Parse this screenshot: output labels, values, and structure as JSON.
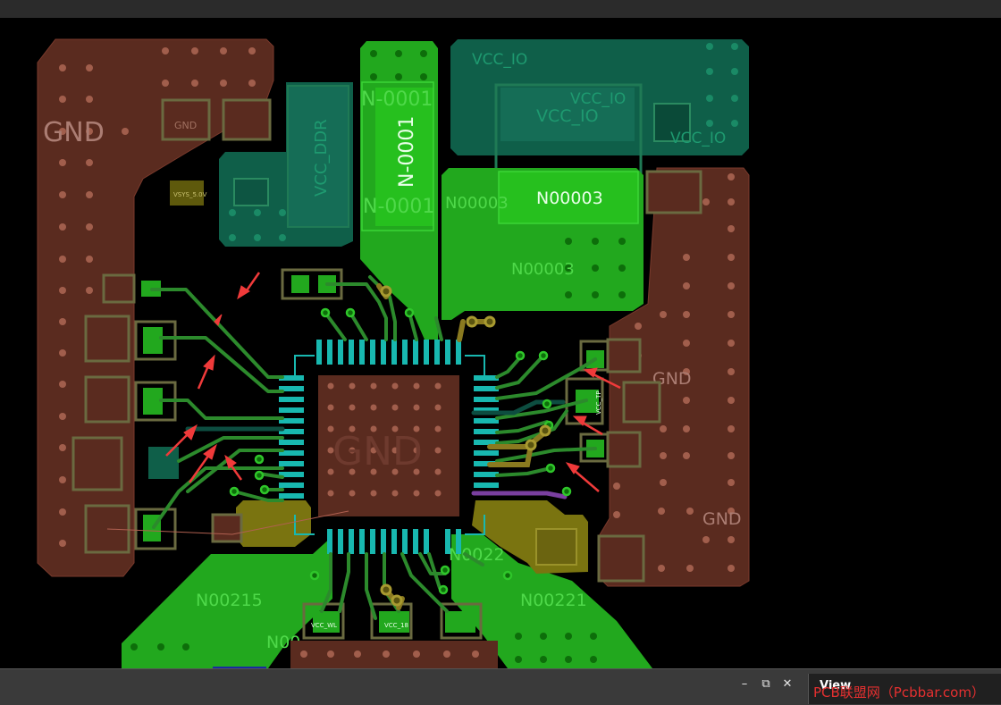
{
  "window": {
    "panel_title": "View",
    "controls": {
      "minimize": "–",
      "restore": "⧉",
      "close": "✕"
    },
    "watermark": "PCB联盟网（Pcbbar.com）"
  },
  "board": {
    "colors": {
      "background": "#000000",
      "gnd_plane": "#5a2b1f",
      "pad_green": "#22a81e",
      "trace_green": "#2c8a2c",
      "net_dark_green": "#0f5f49",
      "net_bright_green": "#26c01e",
      "via_dark": "#a15e4c",
      "pin_cyan": "#1ab8b0",
      "yellow_pour": "#7a7410",
      "purple_trace": "#7a3fa0",
      "arrow_red": "#f03a3a",
      "label_gray": "#ab7d73"
    },
    "nets": {
      "gnd_left": "GND",
      "gnd_center": "GND",
      "gnd_right1": "GND",
      "gnd_right2": "GND",
      "vcc_io1": "VCC_IO",
      "vcc_io2": "VCC_IO",
      "vcc_io3": "VCC_IO",
      "vcc_io4": "VCC_IO",
      "vcc_ddr": "VCC_DDR",
      "n0001_a": "N-0001",
      "n0001_b": "N-0001",
      "n0001_c": "N-0001",
      "n00003_a": "N00003",
      "n00003_b": "N00003",
      "n00003_c": "N00003",
      "n00215": "N00215",
      "n00221": "N00221",
      "n00022": "N0022",
      "n_partial": "N00"
    },
    "component_labels": {
      "gnd_pad": "GND",
      "vsys": "VSYS_5.0V",
      "vcc_wl": "VCC_WL",
      "vcc_18": "VCC_18",
      "vcc_tp": "VCC_TP"
    }
  }
}
